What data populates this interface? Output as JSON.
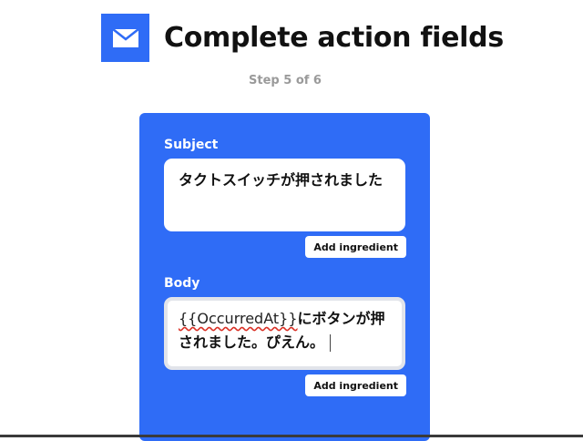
{
  "header": {
    "icon": "envelope-icon",
    "title": "Complete action fields",
    "accent_color": "#2f6cf6"
  },
  "step": {
    "label": "Step 5 of 6"
  },
  "form": {
    "subject": {
      "label": "Subject",
      "value": "タクトスイッチが押されました",
      "add_ingredient_label": "Add ingredient"
    },
    "body": {
      "label": "Body",
      "ingredient": "{{OccurredAt}}",
      "value_text": "にボタンが押されました。ぴえん。",
      "add_ingredient_label": "Add ingredient"
    }
  }
}
